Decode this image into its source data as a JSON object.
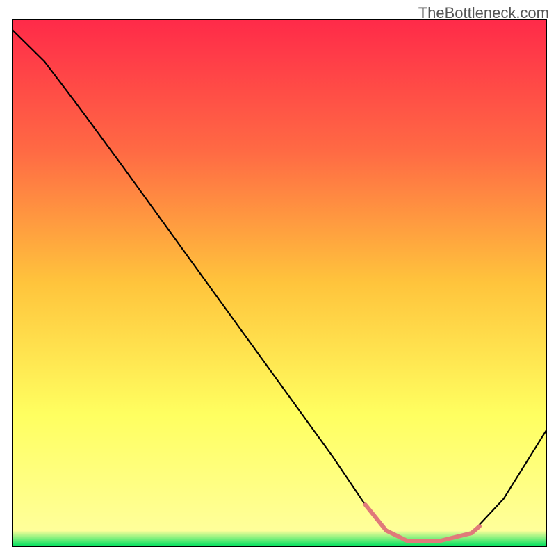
{
  "attribution": "TheBottleneck.com",
  "chart_data": {
    "type": "line",
    "title": "",
    "xlabel": "",
    "ylabel": "",
    "xlim": [
      0,
      100
    ],
    "ylim": [
      0,
      100
    ],
    "background_gradient": {
      "stops": [
        {
          "offset": 0.0,
          "color": "#ff2a49"
        },
        {
          "offset": 0.25,
          "color": "#ff6a44"
        },
        {
          "offset": 0.5,
          "color": "#ffc43c"
        },
        {
          "offset": 0.75,
          "color": "#ffff60"
        },
        {
          "offset": 0.97,
          "color": "#ffff9a"
        },
        {
          "offset": 1.0,
          "color": "#00e060"
        }
      ]
    },
    "series": [
      {
        "name": "bottleneck-curve",
        "color": "#000000",
        "points": [
          {
            "x": 0.0,
            "y": 98.0
          },
          {
            "x": 6.0,
            "y": 92.0
          },
          {
            "x": 12.0,
            "y": 84.0
          },
          {
            "x": 20.0,
            "y": 73.0
          },
          {
            "x": 30.0,
            "y": 59.0
          },
          {
            "x": 40.0,
            "y": 45.0
          },
          {
            "x": 50.0,
            "y": 31.0
          },
          {
            "x": 60.0,
            "y": 17.0
          },
          {
            "x": 66.0,
            "y": 8.0
          },
          {
            "x": 70.0,
            "y": 3.0
          },
          {
            "x": 74.0,
            "y": 1.0
          },
          {
            "x": 80.0,
            "y": 1.0
          },
          {
            "x": 86.0,
            "y": 2.5
          },
          {
            "x": 92.0,
            "y": 9.0
          },
          {
            "x": 100.0,
            "y": 22.0
          }
        ]
      },
      {
        "name": "optimal-range-highlight",
        "color": "#e07a7a",
        "stroke_width": 6,
        "points": [
          {
            "x": 66.1,
            "y": 7.9
          },
          {
            "x": 70.0,
            "y": 3.0
          },
          {
            "x": 74.0,
            "y": 1.0
          },
          {
            "x": 80.0,
            "y": 1.0
          },
          {
            "x": 86.0,
            "y": 2.5
          },
          {
            "x": 87.5,
            "y": 3.8
          }
        ]
      }
    ]
  }
}
